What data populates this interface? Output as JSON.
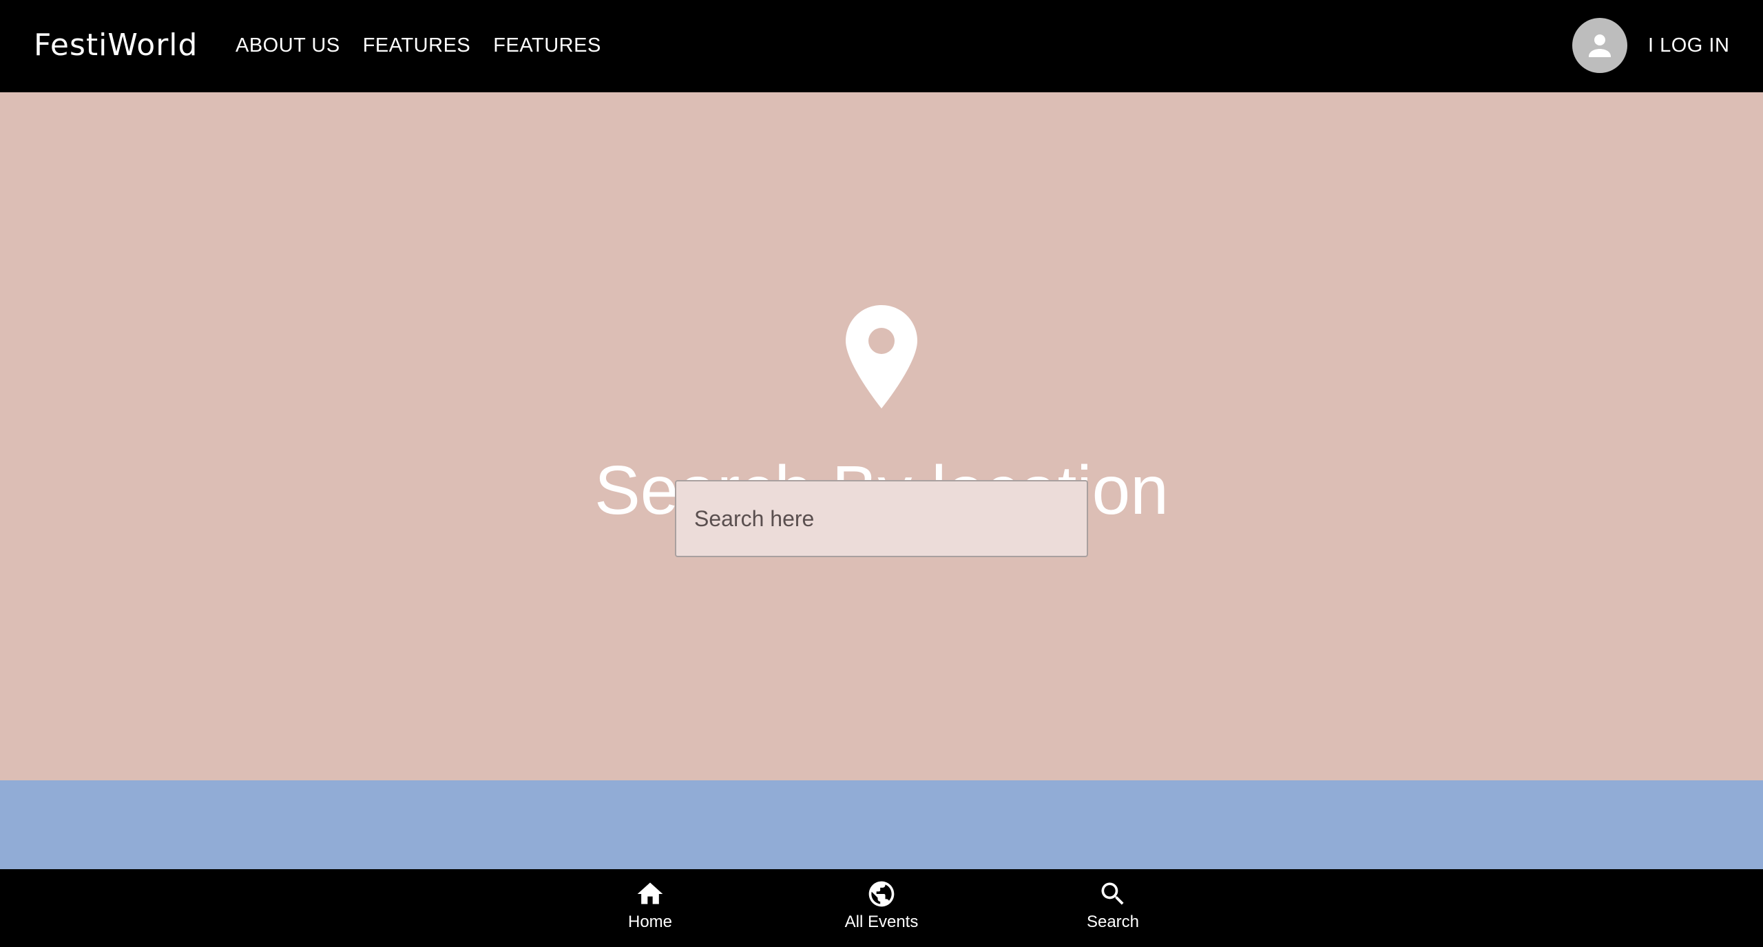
{
  "header": {
    "brand": "FestiWorld",
    "nav": [
      "ABOUT US",
      "FEATURES",
      "FEATURES"
    ],
    "login_label": "I LOG IN",
    "avatar_icon": "person-icon"
  },
  "hero": {
    "icon": "location-pin-icon",
    "title": "Search By location",
    "search": {
      "placeholder": "Search here",
      "value": ""
    }
  },
  "bottom_nav": {
    "items": [
      {
        "label": "Home",
        "icon": "home-icon"
      },
      {
        "label": "All Events",
        "icon": "globe-icon"
      },
      {
        "label": "Search",
        "icon": "search-icon"
      }
    ]
  },
  "colors": {
    "header_bg": "#000000",
    "hero_bg": "#dcbeb5",
    "band_bg": "#91acd6",
    "input_bg": "#ecdcd9",
    "avatar_bg": "#bdbdbd",
    "text": "#ffffff"
  }
}
